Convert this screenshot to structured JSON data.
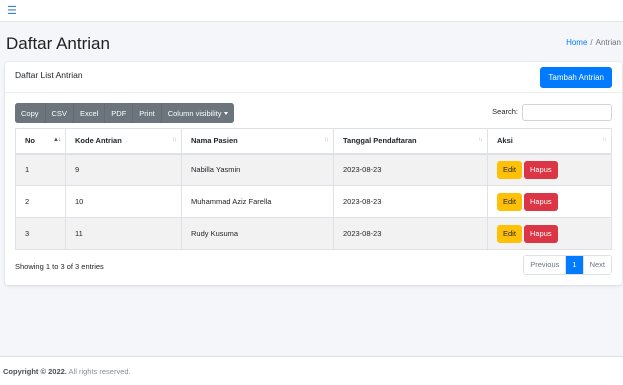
{
  "topbar": {
    "menu_icon": "hamburger-menu-icon"
  },
  "page": {
    "title": "Daftar Antrian",
    "breadcrumb": {
      "home": "Home",
      "separator": "/",
      "current": "Antrian"
    }
  },
  "card": {
    "title": "Daftar List Antrian",
    "add_button": "Tambah Antrian"
  },
  "toolbar": {
    "buttons": [
      "Copy",
      "CSV",
      "Excel",
      "PDF",
      "Print"
    ],
    "column_visibility": "Column visibility"
  },
  "search": {
    "label": "Search:",
    "value": ""
  },
  "table": {
    "headers": [
      "No",
      "Kode Antrian",
      "Nama Pasien",
      "Tanggal Pendaftaran",
      "Aksi"
    ],
    "rows": [
      {
        "no": "1",
        "kode": "9",
        "nama": "Nabilla Yasmin",
        "tanggal": "2023-08-23",
        "edit": "Edit",
        "hapus": "Hapus"
      },
      {
        "no": "2",
        "kode": "10",
        "nama": "Muhammad Aziz Farella",
        "tanggal": "2023-08-23",
        "edit": "Edit",
        "hapus": "Hapus"
      },
      {
        "no": "3",
        "kode": "11",
        "nama": "Rudy Kusuma",
        "tanggal": "2023-08-23",
        "edit": "Edit",
        "hapus": "Hapus"
      }
    ]
  },
  "info": "Showing 1 to 3 of 3 entries",
  "pagination": {
    "previous": "Previous",
    "current": "1",
    "next": "Next"
  },
  "footer": {
    "copyright": "Copyright © 2022.",
    "rights": "All rights reserved."
  },
  "colors": {
    "primary": "#007bff",
    "warning": "#ffc107",
    "danger": "#dc3545",
    "secondary": "#6c757d"
  }
}
